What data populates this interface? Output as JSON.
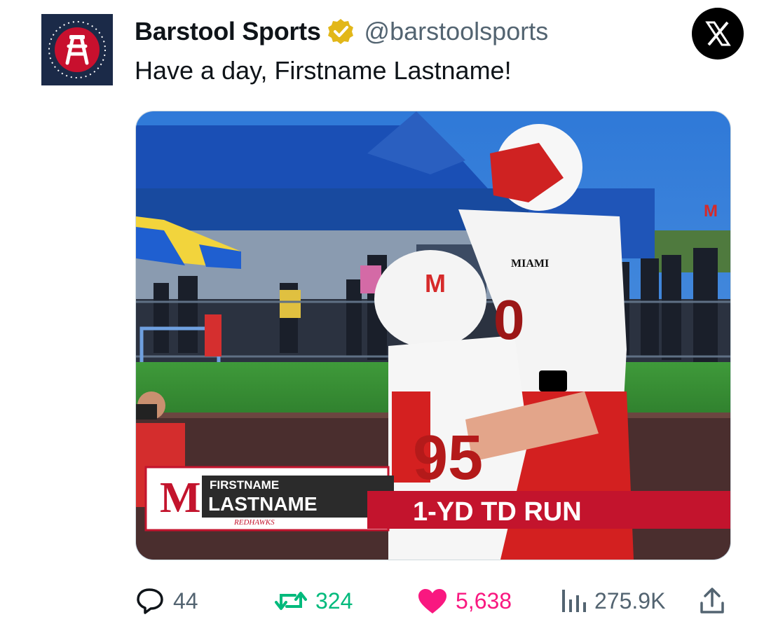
{
  "tweet": {
    "author": {
      "name": "Barstool Sports",
      "handle": "@barstoolsports",
      "verified": true,
      "avatar_icon": "barstool-logo-icon"
    },
    "text": "Have a day, Firstname Lastname!",
    "platform_icon": "x-logo-icon"
  },
  "media": {
    "overlay": {
      "first_name": "FIRSTNAME",
      "last_name": "LASTNAME",
      "team_wordmark": "REDHAWKS",
      "play": "1-YD TD RUN",
      "team_logo_letter": "M"
    },
    "jersey_text": {
      "helmet_letter": "M",
      "school": "MIAMI",
      "numbers": [
        "0",
        "95"
      ]
    }
  },
  "actions": {
    "replies": "44",
    "reposts": "324",
    "likes": "5,638",
    "views": "275.9K"
  },
  "colors": {
    "verified_gold": "#e2b719",
    "repost_green": "#00ba7c",
    "like_pink": "#f91880",
    "muted": "#536471",
    "miami_red": "#c3142d"
  }
}
